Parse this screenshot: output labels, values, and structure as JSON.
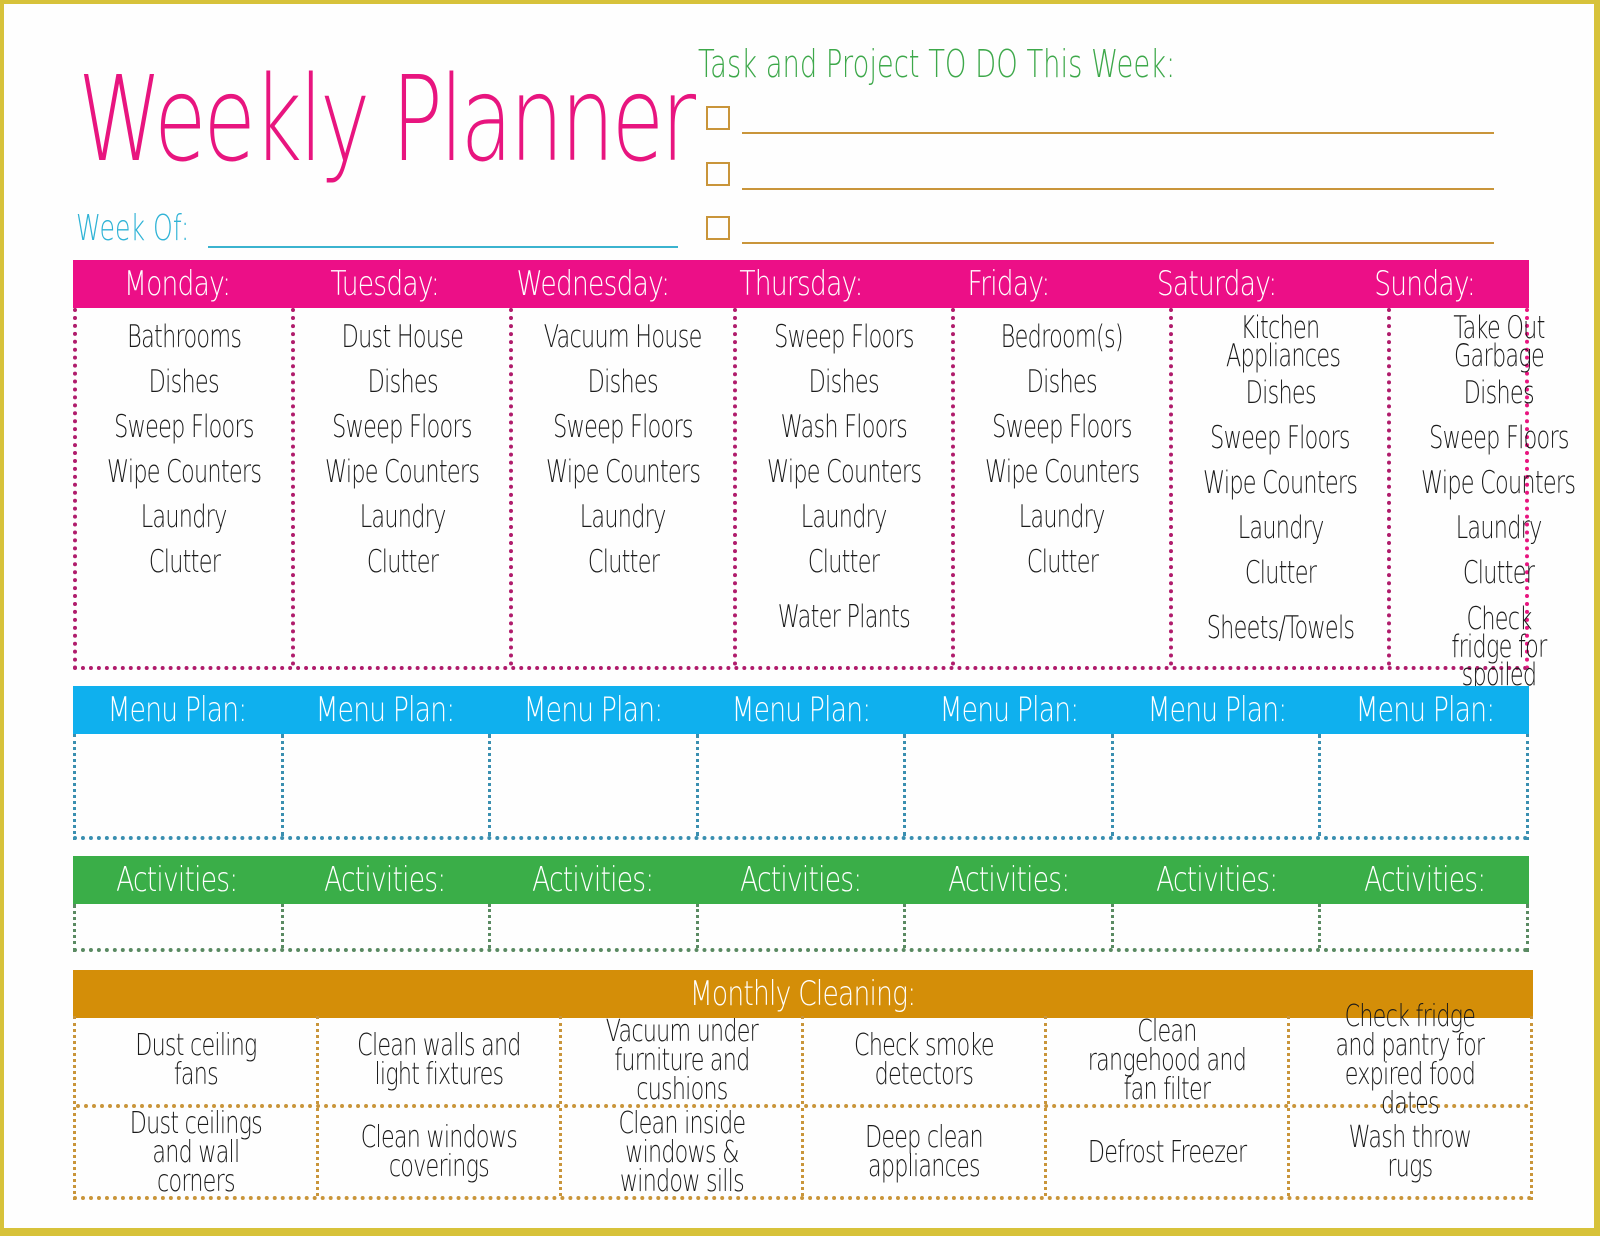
{
  "title": "Weekly Planner",
  "week_of": {
    "label": "Week Of:",
    "value": ""
  },
  "tasks": {
    "title": "Task and Project TO DO This Week:",
    "items": [
      {
        "checked": false,
        "text": ""
      },
      {
        "checked": false,
        "text": ""
      },
      {
        "checked": false,
        "text": ""
      }
    ]
  },
  "colors": {
    "days_header": "#ec0f87",
    "menu_header": "#0fb0ee",
    "activities_header": "#3aae48",
    "monthly_header": "#d48e08",
    "frame": "#d7c23a"
  },
  "days": [
    {
      "label": "Monday:",
      "chores": [
        "Bathrooms",
        "Dishes",
        "Sweep Floors",
        "Wipe Counters",
        "Laundry",
        "Clutter",
        ""
      ]
    },
    {
      "label": "Tuesday:",
      "chores": [
        "Dust House",
        "Dishes",
        "Sweep Floors",
        "Wipe Counters",
        "Laundry",
        "Clutter",
        ""
      ]
    },
    {
      "label": "Wednesday:",
      "chores": [
        "Vacuum House",
        "Dishes",
        "Sweep Floors",
        "Wipe Counters",
        "Laundry",
        "Clutter",
        ""
      ]
    },
    {
      "label": "Thursday:",
      "chores": [
        "Sweep Floors",
        "Dishes",
        "Wash Floors",
        "Wipe Counters",
        "Laundry",
        "Clutter",
        "Water Plants"
      ]
    },
    {
      "label": "Friday:",
      "chores": [
        "Bedroom(s)",
        "Dishes",
        "Sweep Floors",
        "Wipe Counters",
        "Laundry",
        "Clutter",
        ""
      ]
    },
    {
      "label": "Saturday:",
      "chores": [
        "Kitchen Appliances",
        "Dishes",
        "Sweep Floors",
        "Wipe Counters",
        "Laundry",
        "Clutter",
        "Sheets/Towels"
      ]
    },
    {
      "label": "Sunday:",
      "chores": [
        "Take Out Garbage",
        "Dishes",
        "Sweep Floors",
        "Wipe Counters",
        "Laundry",
        "Clutter",
        "Check fridge for spoiled food"
      ]
    }
  ],
  "menu_plan": {
    "label": "Menu Plan:",
    "entries": [
      "",
      "",
      "",
      "",
      "",
      "",
      ""
    ]
  },
  "activities": {
    "label": "Activities:",
    "entries": [
      "",
      "",
      "",
      "",
      "",
      "",
      ""
    ]
  },
  "monthly_cleaning": {
    "label": "Monthly Cleaning:",
    "rows": [
      [
        "Dust ceiling fans",
        "Clean walls and light fixtures",
        "Vacuum under furniture and cushions",
        "Check smoke detectors",
        "Clean rangehood and fan filter",
        "Check fridge and pantry for expired food dates"
      ],
      [
        "Dust ceilings and wall corners",
        "Clean windows coverings",
        "Clean inside windows & window sills",
        "Deep clean appliances",
        "Defrost Freezer",
        "Wash throw rugs"
      ]
    ]
  }
}
